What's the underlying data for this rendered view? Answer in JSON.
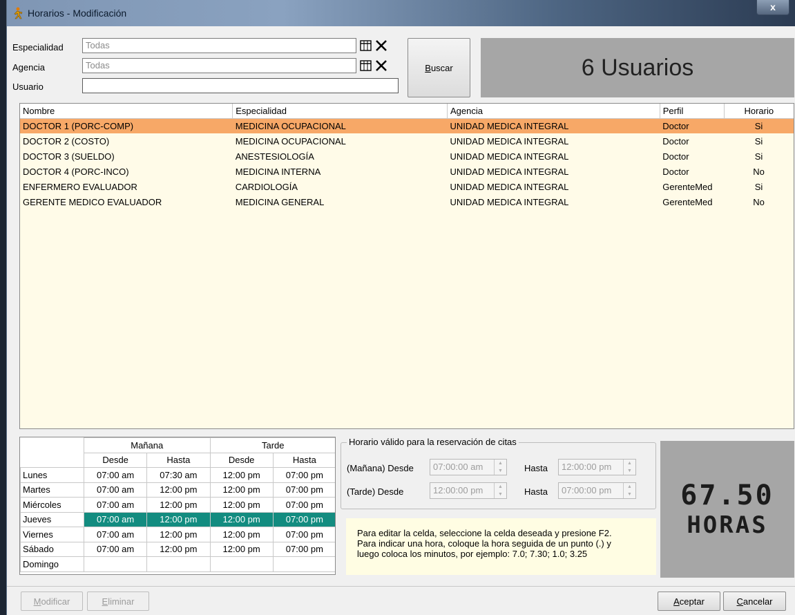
{
  "window": {
    "title": "Horarios - Modificación",
    "close": "x"
  },
  "filters": {
    "especialidad_label": "Especialidad",
    "especialidad_value": "Todas",
    "agencia_label": "Agencia",
    "agencia_value": "Todas",
    "usuario_label": "Usuario",
    "usuario_value": ""
  },
  "buscar_label": "Buscar",
  "users_count": "6 Usuarios",
  "grid": {
    "headers": [
      "Nombre",
      "Especialidad",
      "Agencia",
      "Perfil",
      "Horario"
    ],
    "rows": [
      [
        "DOCTOR 1 (PORC-COMP)",
        "MEDICINA OCUPACIONAL",
        "UNIDAD MEDICA INTEGRAL",
        "Doctor",
        "Si"
      ],
      [
        "DOCTOR 2 (COSTO)",
        "MEDICINA OCUPACIONAL",
        "UNIDAD MEDICA INTEGRAL",
        "Doctor",
        "Si"
      ],
      [
        "DOCTOR 3 (SUELDO)",
        "ANESTESIOLOGÍA",
        "UNIDAD MEDICA INTEGRAL",
        "Doctor",
        "Si"
      ],
      [
        "DOCTOR 4 (PORC-INCO)",
        "MEDICINA INTERNA",
        "UNIDAD MEDICA INTEGRAL",
        "Doctor",
        "No"
      ],
      [
        "ENFERMERO EVALUADOR",
        "CARDIOLOGÍA",
        "UNIDAD MEDICA INTEGRAL",
        "GerenteMed",
        "Si"
      ],
      [
        "GERENTE MEDICO EVALUADOR",
        "MEDICINA GENERAL",
        "UNIDAD MEDICA INTEGRAL",
        "GerenteMed",
        "No"
      ]
    ],
    "selected_row": 0
  },
  "schedule": {
    "group_manana": "Mañana",
    "group_tarde": "Tarde",
    "desde": "Desde",
    "hasta": "Hasta",
    "days": [
      {
        "day": "Lunes",
        "m_desde": "07:00 am",
        "m_hasta": "07:30 am",
        "t_desde": "12:00 pm",
        "t_hasta": "07:00 pm"
      },
      {
        "day": "Martes",
        "m_desde": "07:00 am",
        "m_hasta": "12:00 pm",
        "t_desde": "12:00 pm",
        "t_hasta": "07:00 pm"
      },
      {
        "day": "Miércoles",
        "m_desde": "07:00 am",
        "m_hasta": "12:00 pm",
        "t_desde": "12:00 pm",
        "t_hasta": "07:00 pm"
      },
      {
        "day": "Jueves",
        "m_desde": "07:00 am",
        "m_hasta": "12:00 pm",
        "t_desde": "12:00 pm",
        "t_hasta": "07:00 pm"
      },
      {
        "day": "Viernes",
        "m_desde": "07:00 am",
        "m_hasta": "12:00 pm",
        "t_desde": "12:00 pm",
        "t_hasta": "07:00 pm"
      },
      {
        "day": "Sábado",
        "m_desde": "07:00 am",
        "m_hasta": "12:00 pm",
        "t_desde": "12:00 pm",
        "t_hasta": "07:00 pm"
      },
      {
        "day": "Domingo",
        "m_desde": "",
        "m_hasta": "",
        "t_desde": "",
        "t_hasta": ""
      }
    ],
    "selected_day": 3
  },
  "valid": {
    "legend": "Horario válido para la reservación de citas",
    "manana_desde_label": "(Mañana) Desde",
    "manana_desde": "07:00:00 am",
    "hasta_label": "Hasta",
    "manana_hasta": "12:00:00 pm",
    "tarde_desde_label": "(Tarde) Desde",
    "tarde_desde": "12:00:00 pm",
    "tarde_hasta": "07:00:00 pm"
  },
  "help_text": [
    "Para editar la celda, seleccione la celda deseada y presione F2.",
    "Para indicar una hora, coloque la hora seguida de un punto (.) y",
    "luego coloca los minutos, por ejemplo: 7.0; 7.30; 1.0; 3.25"
  ],
  "hours": {
    "value": "67.50",
    "unit": "HORAS"
  },
  "buttons": {
    "modificar": "Modificar",
    "eliminar": "Eliminar",
    "aceptar": "Aceptar",
    "cancelar": "Cancelar"
  },
  "colors": {
    "selected_row": "#f7a867",
    "selected_day": "#138c80",
    "grid_bg": "#fffbe8"
  }
}
